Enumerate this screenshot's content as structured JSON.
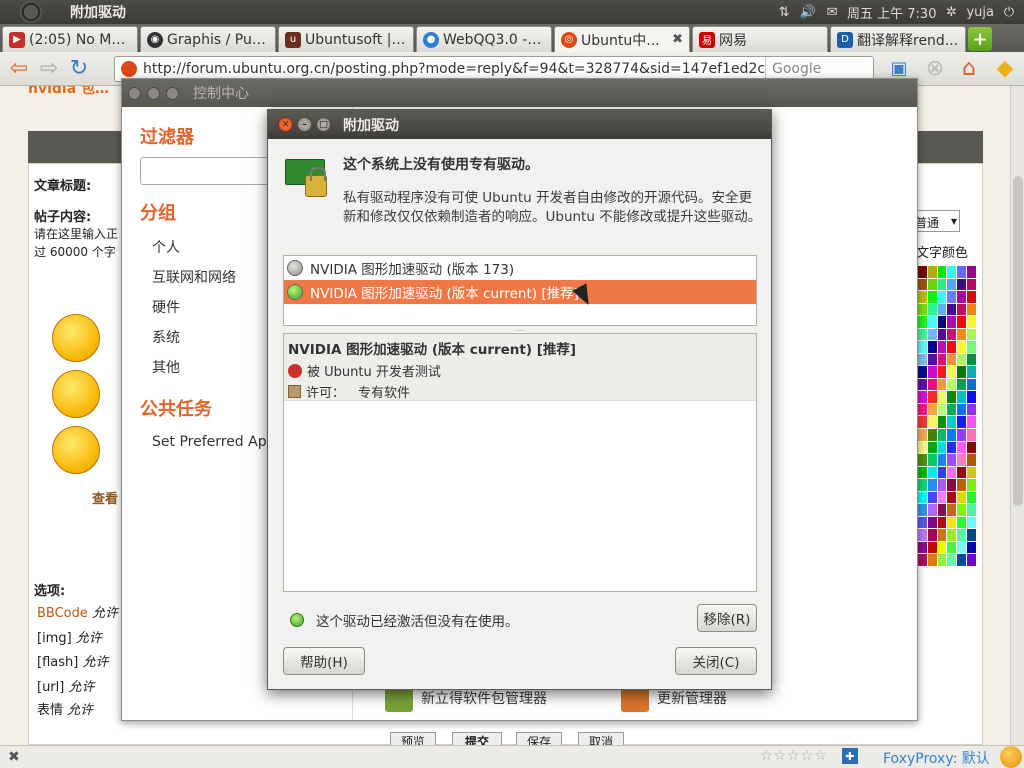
{
  "topbar": {
    "app_title": "附加驱动",
    "clock": "周五 上午 7:30",
    "user": "yuja"
  },
  "tabs": [
    {
      "label": "(2:05) No Mor...",
      "icon": "youtube-icon"
    },
    {
      "label": "Graphis / Pub...",
      "icon": "github-icon"
    },
    {
      "label": "Ubuntusoft | ...",
      "icon": "site-icon"
    },
    {
      "label": "WebQQ3.0 - ...",
      "icon": "globe-icon"
    },
    {
      "label": "Ubuntu中...",
      "icon": "ubuntu-icon",
      "active": true
    },
    {
      "label": "网易",
      "icon": "netease-icon"
    },
    {
      "label": "翻译解释rend...",
      "icon": "dict-icon"
    }
  ],
  "navbar": {
    "url": "http://forum.ubuntu.org.cn/posting.php?mode=reply&f=94&t=328774&sid=147ef1ed2c6e",
    "search_placeholder": "Google"
  },
  "forum": {
    "subject_label": "文章标题:",
    "content_label": "帖子内容:",
    "content_hint_1": "请在这里输入正",
    "content_hint_2": "过 60000 个字",
    "view_more": "查看",
    "font_size_value": "普通",
    "font_color_label": "文字颜色",
    "options_label": "选项:",
    "options": [
      {
        "name": "BBCode",
        "value": "允许"
      },
      {
        "name": "[img]",
        "value": "允许"
      },
      {
        "name": "[flash]",
        "value": "允许"
      },
      {
        "name": "[url]",
        "value": "允许"
      },
      {
        "name": "表情",
        "value": "允许"
      }
    ],
    "bottom_buttons": [
      "预览",
      "提交",
      "保存",
      "取消"
    ],
    "heading_fragment": "nvidia 包…"
  },
  "control_center": {
    "title": "控制中心",
    "filter_section": "过滤器",
    "group_section": "分组",
    "groups": [
      "个人",
      "互联网和网络",
      "硬件",
      "系统",
      "其他"
    ],
    "common_tasks_section": "公共任务",
    "tasks": [
      "Set Preferred Applications"
    ],
    "bottom_apps": [
      "新立得软件包管理器",
      "更新管理器"
    ]
  },
  "dialog": {
    "title": "附加驱动",
    "headline": "这个系统上没有使用专有驱动。",
    "description": "私有驱动程序没有可使 Ubuntu 开发者自由修改的开源代码。安全更新和修改仅仅依赖制造者的响应。Ubuntu 不能修改或提升这些驱动。",
    "drivers": [
      {
        "name": "NVIDIA 图形加速驱动 (版本 173)",
        "state": "inactive"
      },
      {
        "name": "NVIDIA 图形加速驱动 (版本 current) [推荐]",
        "state": "active",
        "selected": true
      }
    ],
    "detail_title": "NVIDIA 图形加速驱动 (版本 current) [推荐]",
    "detail_tested": "被 Ubuntu 开发者测试",
    "detail_license_label": "许可：",
    "detail_license_value": "专有软件",
    "status_text": "这个驱动已经激活但没有在使用。",
    "remove_button": "移除(R)",
    "help_button": "帮助(H)",
    "close_button": "关闭(C)"
  },
  "statusbar": {
    "foxyproxy": "FoxyProxy: 默认"
  },
  "colors": {
    "ubuntu_orange": "#f07746",
    "section_orange": "#e0642c",
    "titlebar_dark": "#3e3d39"
  }
}
